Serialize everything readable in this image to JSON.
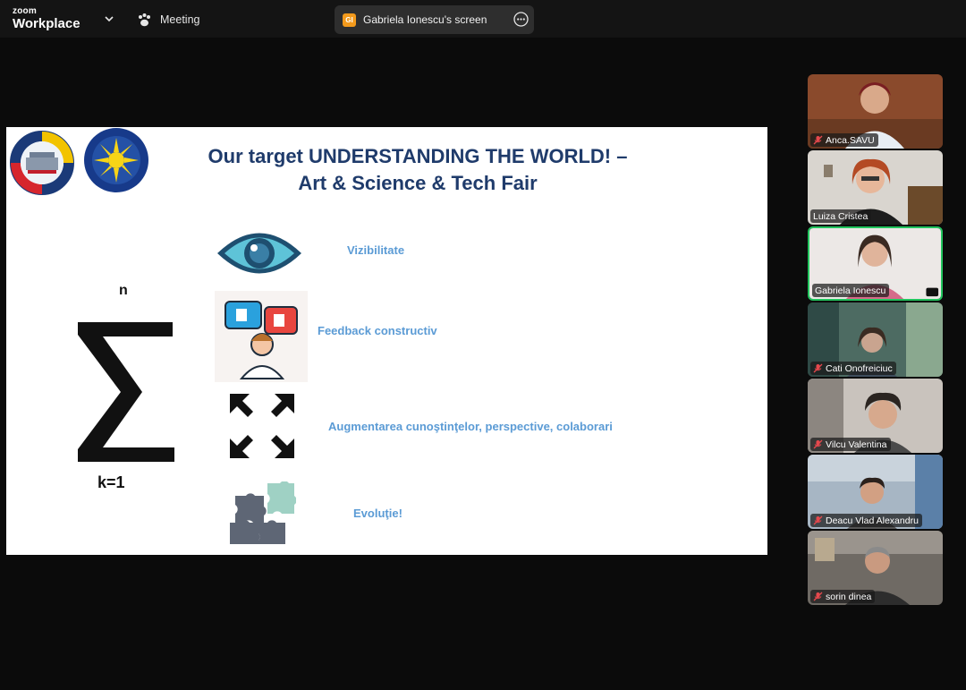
{
  "app": {
    "logo_line1": "zoom",
    "logo_line2": "Workplace",
    "meeting_label": "Meeting",
    "share_initials": "GI",
    "share_label": "Gabriela Ionescu's screen"
  },
  "slide": {
    "title_line1": "Our target UNDERSTANDING THE WORLD! –",
    "title_line2": "Art & Science & Tech Fair",
    "sigma_top": "n",
    "sigma_bottom": "k=1",
    "items": [
      {
        "icon": "eye-icon",
        "text": "Vizibilitate"
      },
      {
        "icon": "feedback-icon",
        "text": "Feedback constructiv"
      },
      {
        "icon": "expand-arrows-icon",
        "text": "Augmentarea cunoştinţelor, perspective, colaborari"
      },
      {
        "icon": "puzzle-icon",
        "text": "Evoluţie!"
      }
    ],
    "title_color": "#1f3b6b",
    "item_color": "#5b9bd5"
  },
  "participants": [
    {
      "name": "Anca.SAVU",
      "muted": true,
      "active": false
    },
    {
      "name": "Luiza Cristea",
      "muted": false,
      "active": false
    },
    {
      "name": "Gabriela Ionescu",
      "muted": false,
      "active": true
    },
    {
      "name": "Cati Onofreiciuc",
      "muted": true,
      "active": false
    },
    {
      "name": "Vilcu Valentina",
      "muted": true,
      "active": false
    },
    {
      "name": "Deacu Vlad Alexandru",
      "muted": true,
      "active": false
    },
    {
      "name": "sorin dinea",
      "muted": true,
      "active": false
    }
  ],
  "colors": {
    "active_speaker": "#22c55e",
    "muted_mic": "#e5484d",
    "share_badge": "#f39a1c"
  }
}
